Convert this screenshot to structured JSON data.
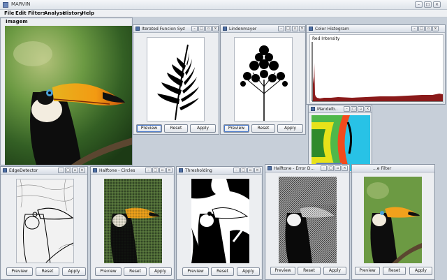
{
  "window": {
    "title": "MARVIN"
  },
  "menu": [
    {
      "label": "File"
    },
    {
      "label": "Edit"
    },
    {
      "label": "Filters"
    },
    {
      "label": "Analyse"
    },
    {
      "label": "History"
    },
    {
      "label": "Help"
    }
  ],
  "main_image": {
    "title": "Imagem"
  },
  "buttons": {
    "preview": "Preview",
    "reset": "Reset",
    "apply": "Apply"
  },
  "frames": {
    "ifs": {
      "title": "Iterated Funcion Syst..."
    },
    "lindenmayer": {
      "title": "Lindenmayer"
    },
    "histogram": {
      "title": "Color Histogram",
      "label": "Red Intensity"
    },
    "mandelbrot": {
      "title": "Mandelb..."
    },
    "edge": {
      "title": "EdgeDetector"
    },
    "halftone_circles": {
      "title": "Halftone - Circles"
    },
    "thresholding": {
      "title": "Thresholding"
    },
    "halftone_error": {
      "title": "Halftone - Error D..."
    },
    "image_filter": {
      "title": "...e Filter"
    }
  },
  "colors": {
    "desktop": "#c7cfd9",
    "histogram_red": "#8a1a1a",
    "focus": "#4a78c8"
  }
}
